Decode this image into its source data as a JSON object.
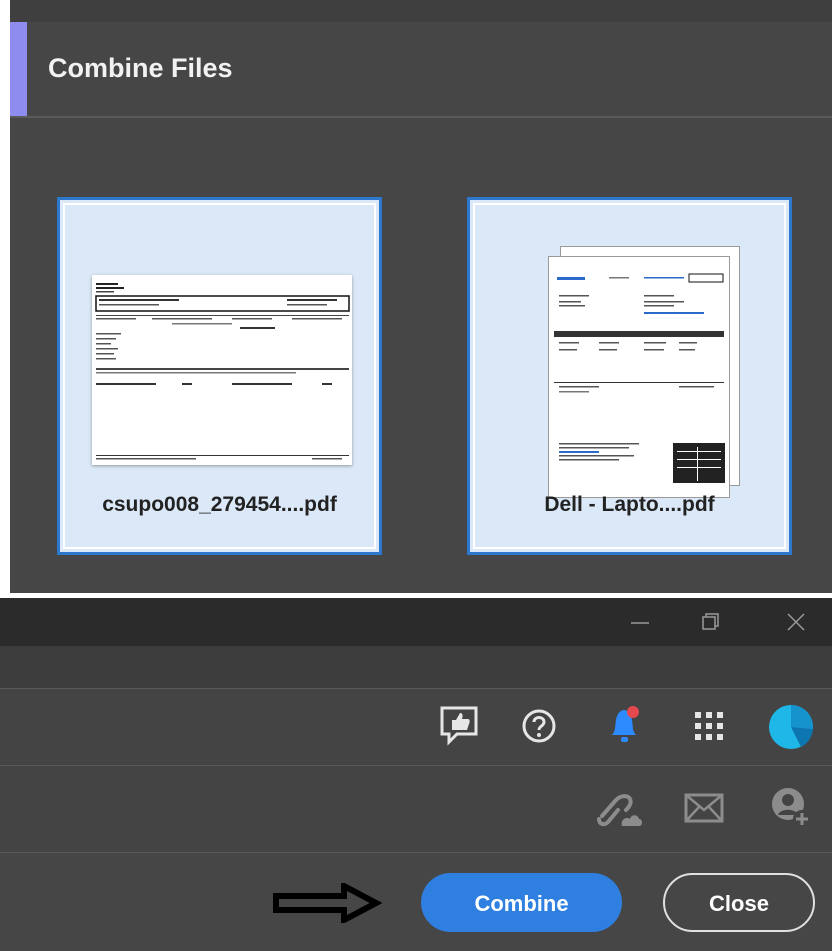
{
  "dialog": {
    "title": "Combine Files",
    "accent_color": "#8f8cf0",
    "files": [
      {
        "name": "csupo008_279454....pdf"
      },
      {
        "name": "Dell - Lapto....pdf"
      }
    ]
  },
  "window_controls": {
    "minimize": "minimize-icon",
    "restore": "restore-icon",
    "close": "close-icon"
  },
  "toolbar": {
    "icons": [
      "feedback-icon",
      "help-icon",
      "notification-bell-icon",
      "apps-grid-icon",
      "account-avatar-icon"
    ],
    "notification_dot_color": "#e5484d"
  },
  "share_toolbar": {
    "icons": [
      "share-link-icon",
      "email-icon",
      "add-user-icon"
    ]
  },
  "footer": {
    "combine_label": "Combine",
    "close_label": "Close",
    "combine_color": "#2e7fe0",
    "arrow": "arrow-right-icon"
  }
}
